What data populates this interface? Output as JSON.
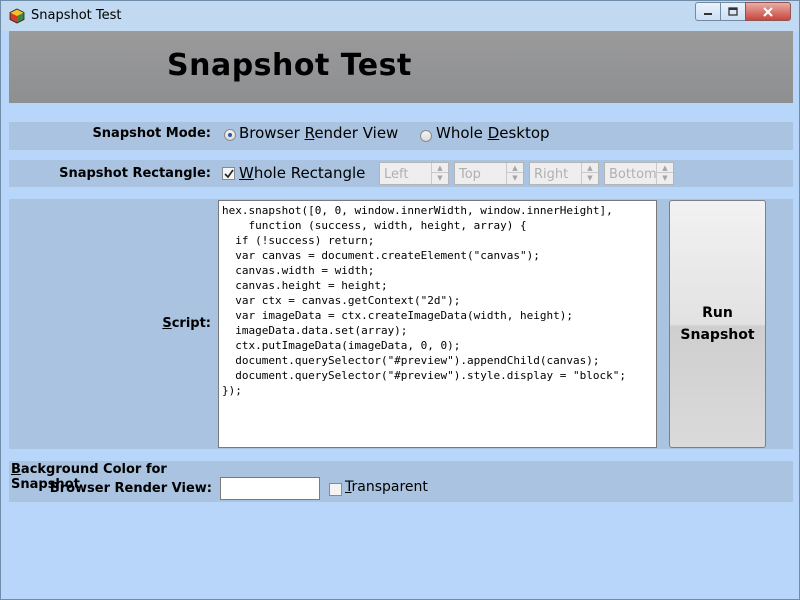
{
  "window": {
    "title": "Snapshot Test"
  },
  "header": {
    "title": "Snapshot Test"
  },
  "snapshot_mode": {
    "label": "Snapshot Mode:",
    "options": [
      {
        "label": "Browser Render View",
        "selected": true
      },
      {
        "label": "Whole Desktop",
        "selected": false
      }
    ]
  },
  "snapshot_rectangle": {
    "label": "Snapshot Rectangle:",
    "whole_rectangle_label": "Whole Rectangle",
    "whole_rectangle_checked": true,
    "fields": {
      "left": {
        "placeholder": "Left"
      },
      "top": {
        "placeholder": "Top"
      },
      "right": {
        "placeholder": "Right"
      },
      "bottom": {
        "placeholder": "Bottom"
      }
    }
  },
  "script": {
    "label": "Script:",
    "code": "hex.snapshot([0, 0, window.innerWidth, window.innerHeight],\n    function (success, width, height, array) {\n  if (!success) return;\n  var canvas = document.createElement(\"canvas\");\n  canvas.width = width;\n  canvas.height = height;\n  var ctx = canvas.getContext(\"2d\");\n  var imageData = ctx.createImageData(width, height);\n  imageData.data.set(array);\n  ctx.putImageData(imageData, 0, 0);\n  document.querySelector(\"#preview\").appendChild(canvas);\n  document.querySelector(\"#preview\").style.display = \"block\";\n});",
    "run_button_line1": "Run",
    "run_button_line2": "Snapshot"
  },
  "background": {
    "label_line1": "Background Color for Snapshot",
    "label_line2": "Browser Render View:",
    "value": "",
    "transparent_label": "Transparent",
    "transparent_checked": false
  },
  "colors": {
    "client_bg": "#b7d6f9",
    "band_bg": "#a9c3e0",
    "header_bg": "#959697"
  }
}
